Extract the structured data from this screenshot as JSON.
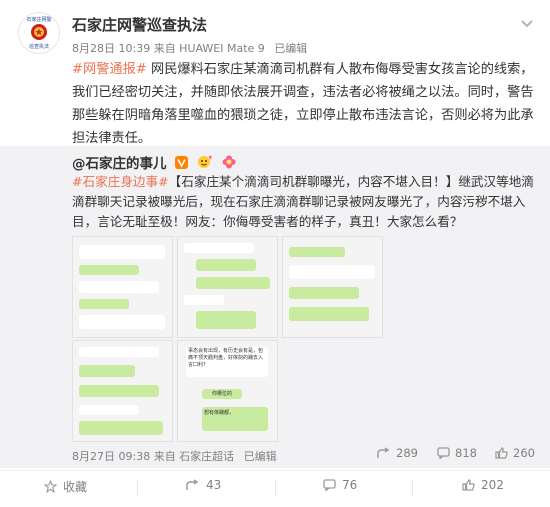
{
  "post": {
    "author": "石家庄网警巡查执法",
    "meta": "8月28日 10:39 来自 HUAWEI Mate 9",
    "edited": "已编辑",
    "hashtag": "#网警通报#",
    "body": " 网民爆料石家庄某滴滴司机群有人散布侮辱受害女孩言论的线索，我们已经密切关注，并随即依法展开调查，违法者必将被绳之以法。同时，警告那些躲在阴暗角落里噬血的猥琐之徒，立即停止散布违法言论，否则必将为此承担法律责任。",
    "avatar_text_top": "石家庄网警",
    "avatar_text_bottom": "巡查执法"
  },
  "repost": {
    "author": "@石家庄的事儿",
    "hashtag": "#石家庄身边事#",
    "body": "【石家庄某个滴滴司机群聊曝光，内容不堪入目！】继武汉等地滴滴群聊天记录被曝光后，现在石家庄滴滴群聊记录被网友曝光了，内容污秽不堪入目，言论无耻至极！网友：你侮辱受害者的样子，真丑！大家怎么看？",
    "meta": "8月27日 09:38 来自 石家庄超话",
    "edited": "已编辑",
    "shares": "289",
    "comments": "818",
    "likes": "260",
    "thumb_bubble_1": "事态会有出现，有历史会有是，包痛不顶天戳判盘，好傢劍的踐去入言口利?",
    "thumb_reply_1": "你哪位的",
    "thumb_reply_2": "想有傢踐都，"
  },
  "toolbar": {
    "favorite": "收藏",
    "reposts": "43",
    "comments": "76",
    "likes": "202"
  },
  "colors": {
    "accent": "#eb7350",
    "chat_green": "#c9eba0",
    "text": "#333333",
    "muted": "#808080"
  }
}
